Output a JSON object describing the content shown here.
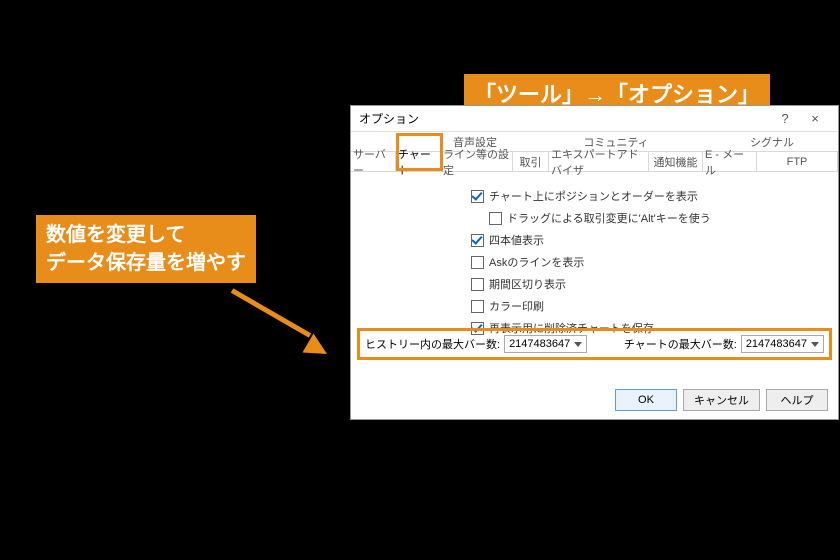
{
  "annotations": {
    "top_callout": "「ツール」→「オプション」",
    "left_callout_line1": "数値を変更して",
    "left_callout_line2": "データ保存量を増やす"
  },
  "dialog": {
    "title": "オプション",
    "help_symbol": "?",
    "close_symbol": "×",
    "tabs_top": {
      "audio": "音声設定",
      "community": "コミュニティ",
      "signal": "シグナル"
    },
    "tabs_bottom": {
      "server": "サーバー",
      "chart": "チャート",
      "line": "ライン等の設定",
      "trade": "取引",
      "ea": "エキスパートアドバイザ",
      "notify": "通知機能",
      "email": "E - メール",
      "ftp": "FTP"
    },
    "checks": {
      "show_positions": "チャート上にポジションとオーダーを表示",
      "drag_alt": "ドラッグによる取引変更に'Alt'キーを使う",
      "yonhone": "四本値表示",
      "ask_line": "Askのラインを表示",
      "period_sep": "期間区切り表示",
      "color_print": "カラー印刷",
      "save_deleted": "再表示用に削除済チャートを保存"
    },
    "bars": {
      "history_label": "ヒストリー内の最大バー数:",
      "history_value": "2147483647",
      "chart_label": "チャートの最大バー数:",
      "chart_value": "2147483647"
    },
    "buttons": {
      "ok": "OK",
      "cancel": "キャンセル",
      "help": "ヘルプ"
    }
  }
}
